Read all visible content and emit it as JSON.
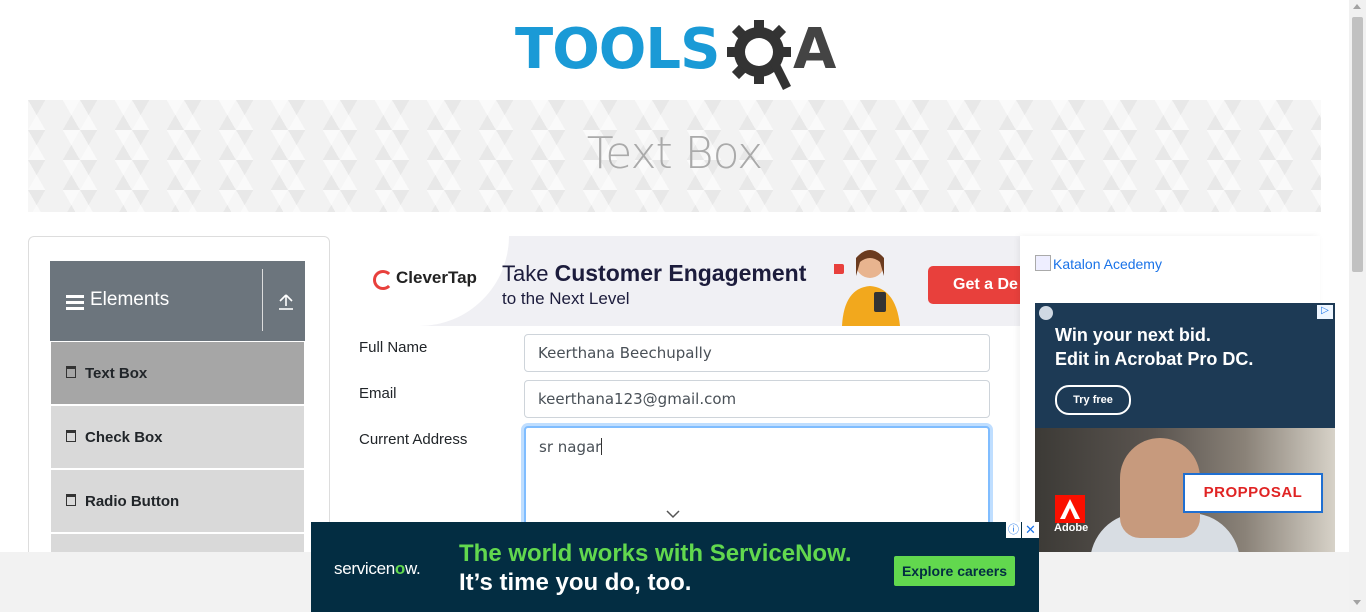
{
  "header": {
    "logo_text_left": "TOOLS",
    "logo_text_right": "A"
  },
  "banner": {
    "title": "Text Box"
  },
  "sidebar": {
    "group_label": "Elements",
    "items": [
      {
        "label": "Text Box",
        "active": true
      },
      {
        "label": "Check Box",
        "active": false
      },
      {
        "label": "Radio Button",
        "active": false
      }
    ]
  },
  "top_ad": {
    "brand": "CleverTap",
    "line1_prefix": "Take",
    "line1_bold": "Customer Engagement",
    "line2": "to the Next Level",
    "cta": "Get a De"
  },
  "form": {
    "full_name": {
      "label": "Full Name",
      "value": "Keerthana Beechupally"
    },
    "email": {
      "label": "Email",
      "value": "keerthana123@gmail.com"
    },
    "current_address": {
      "label": "Current Address",
      "value": "sr nagar"
    }
  },
  "right_panel": {
    "katalon_alt": "Katalon Acedemy",
    "adobe": {
      "headline1": "Win your next bid.",
      "headline2": "Edit in Acrobat Pro DC.",
      "cta": "Try free",
      "proposal_text": "PROPPOSAL",
      "brand_label": "Adobe",
      "adchoices": "▷"
    }
  },
  "bottom_ad": {
    "brand_prefix": "servicen",
    "brand_o": "o",
    "brand_suffix": "w.",
    "line1": "The world works with ServiceNow.",
    "line2": "It’s time you do, too.",
    "cta": "Explore careers",
    "info": "ⓘ",
    "close": "✕"
  },
  "colors": {
    "brand_blue": "#1a9ad6",
    "menu_header": "#6c757d",
    "servicenow_green": "#62d84e",
    "clevertap_red": "#e8403c"
  }
}
